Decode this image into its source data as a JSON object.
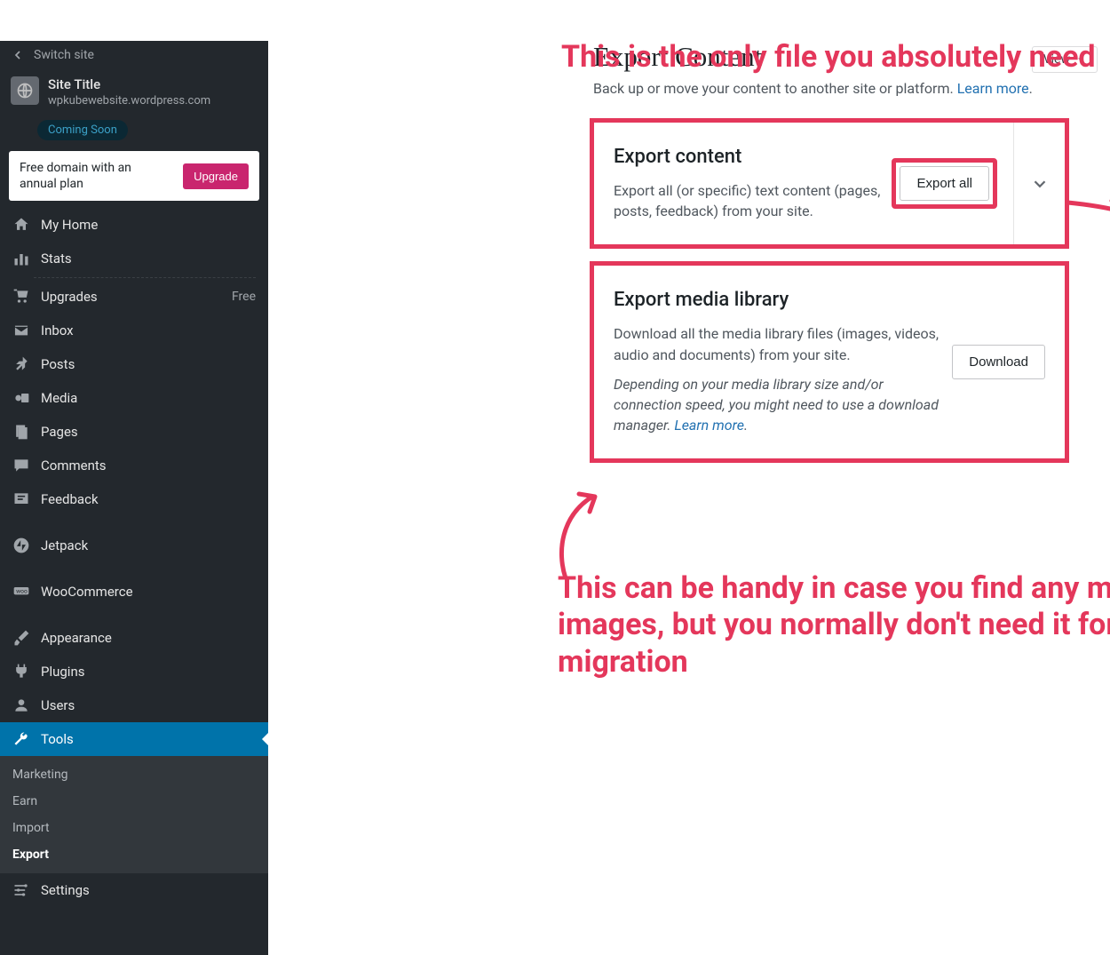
{
  "sidebar": {
    "switch_site": "Switch site",
    "site_title": "Site Title",
    "site_url": "wpkubewebsite.wordpress.com",
    "coming_soon": "Coming Soon",
    "promo_text": "Free domain with an annual plan",
    "promo_btn": "Upgrade",
    "nav": [
      {
        "label": "My Home",
        "badge": ""
      },
      {
        "label": "Stats",
        "badge": ""
      },
      {
        "label": "Upgrades",
        "badge": "Free"
      },
      {
        "label": "Inbox",
        "badge": ""
      },
      {
        "label": "Posts",
        "badge": ""
      },
      {
        "label": "Media",
        "badge": ""
      },
      {
        "label": "Pages",
        "badge": ""
      },
      {
        "label": "Comments",
        "badge": ""
      },
      {
        "label": "Feedback",
        "badge": ""
      },
      {
        "label": "Jetpack",
        "badge": ""
      },
      {
        "label": "WooCommerce",
        "badge": ""
      },
      {
        "label": "Appearance",
        "badge": ""
      },
      {
        "label": "Plugins",
        "badge": ""
      },
      {
        "label": "Users",
        "badge": ""
      },
      {
        "label": "Tools",
        "badge": ""
      },
      {
        "label": "Settings",
        "badge": ""
      }
    ],
    "sub": [
      "Marketing",
      "Earn",
      "Import",
      "Export"
    ]
  },
  "header": {
    "view_btn": "View"
  },
  "page": {
    "title": "Export Content",
    "desc_pre": "Back up or move your content to another site or platform. ",
    "desc_link": "Learn more",
    "desc_post": "."
  },
  "card1": {
    "title": "Export content",
    "desc": "Export all (or specific) text content (pages, posts, feedback) from your site.",
    "btn": "Export all"
  },
  "card2": {
    "title": "Export media library",
    "desc": "Download all the media library files (images, videos, audio and documents) from your site.",
    "note_pre": "Depending on your media library size and/or connection speed, you might need to use a download manager. ",
    "note_link": "Learn more",
    "note_post": ".",
    "btn": "Download"
  },
  "annotations": {
    "top": "This is the only file you absolutely need",
    "bottom": "This can be handy in case you find any missing images, but you normally don't need it for the migration"
  }
}
